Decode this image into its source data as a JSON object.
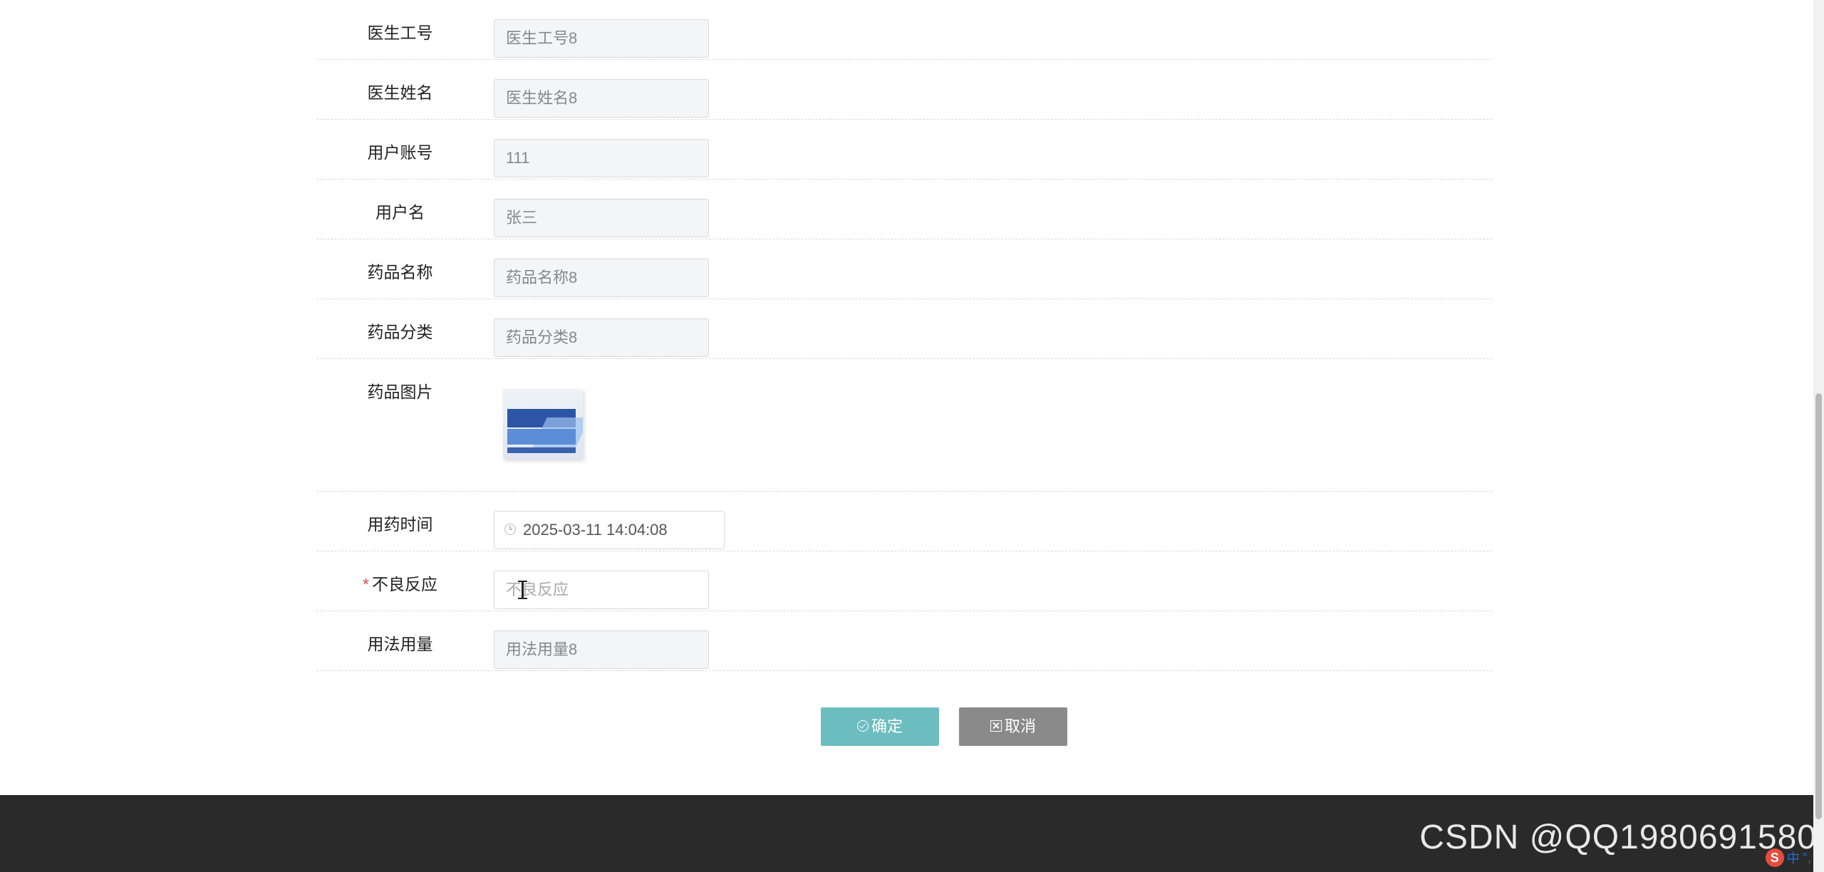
{
  "form": {
    "fields": [
      {
        "label": "医生工号",
        "value": "医生工号8"
      },
      {
        "label": "医生姓名",
        "value": "医生姓名8"
      },
      {
        "label": "用户账号",
        "value": "111"
      },
      {
        "label": "用户名",
        "value": "张三"
      },
      {
        "label": "药品名称",
        "value": "药品名称8"
      },
      {
        "label": "药品分类",
        "value": "药品分类8"
      }
    ],
    "image_label": "药品图片",
    "time": {
      "label": "用药时间",
      "value": "2025-03-11 14:04:08"
    },
    "reaction": {
      "label": "不良反应",
      "required_mark": "*",
      "placeholder": "不良反应"
    },
    "usage": {
      "label": "用法用量",
      "value": "用法用量8"
    }
  },
  "buttons": {
    "confirm": "确定",
    "cancel": "取消"
  },
  "watermark": "CSDN @QQ1980691580",
  "ime": {
    "logo": "S",
    "lang": "中",
    "mode": "°,"
  }
}
